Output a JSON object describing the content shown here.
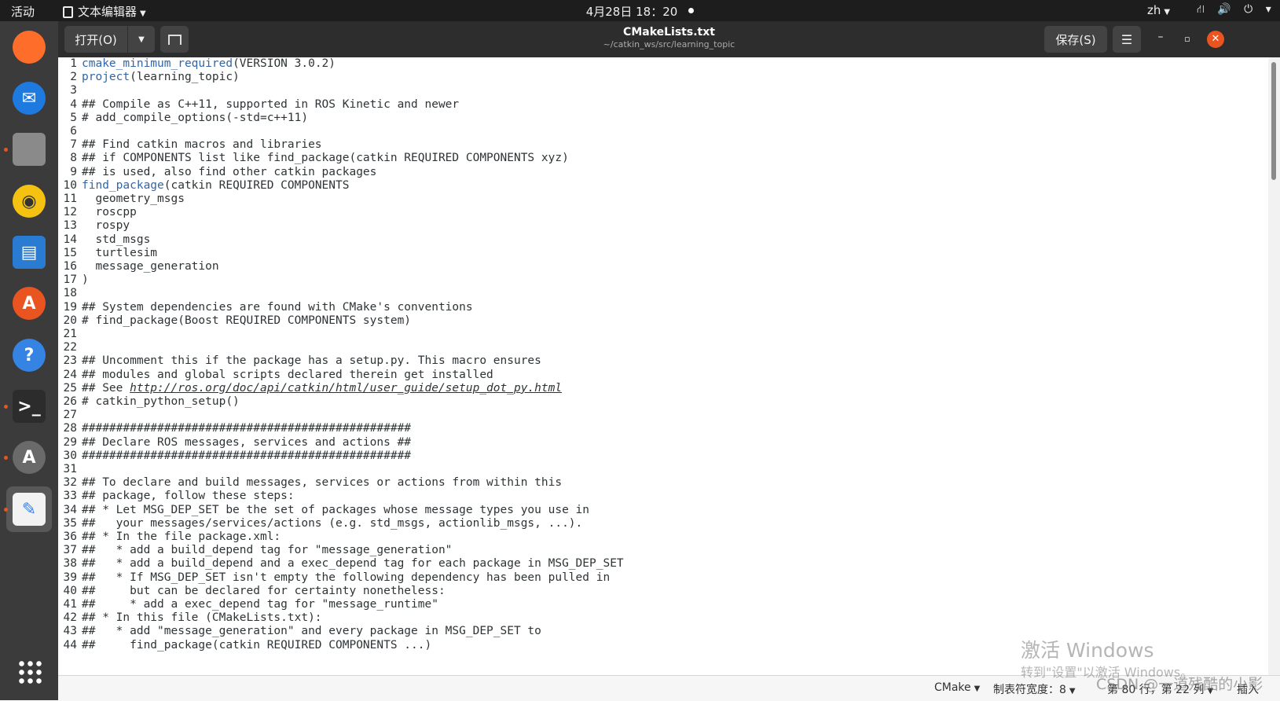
{
  "topbar": {
    "activities": "活动",
    "app_name": "文本编辑器",
    "clock": "4月28日  18：20",
    "lang": "zh",
    "system_icons": "⛙ 🔊 ⏻ ▾"
  },
  "dock": {
    "items": [
      {
        "name": "firefox",
        "label": "",
        "color": "#ff6d2a"
      },
      {
        "name": "thunderbird",
        "label": "✉",
        "color": "#1f7ae0"
      },
      {
        "name": "files",
        "label": "",
        "color": "#8a8a8a"
      },
      {
        "name": "rhythmbox",
        "label": "◉",
        "color": "#f5c211"
      },
      {
        "name": "libreoffice-writer",
        "label": "▤",
        "color": "#2a7cd3"
      },
      {
        "name": "ubuntu-software",
        "label": "A",
        "color": "#e95420"
      },
      {
        "name": "help",
        "label": "?",
        "color": "#3584e4"
      },
      {
        "name": "terminal",
        "label": ">_",
        "color": "#2c2c2c"
      },
      {
        "name": "software-updater",
        "label": "A",
        "color": "#6a6a6a"
      },
      {
        "name": "text-editor",
        "label": "✎",
        "color": "#f2f2f2"
      }
    ]
  },
  "header": {
    "open_label": "打开(O)",
    "title": "CMakeLists.txt",
    "path": "~/catkin_ws/src/learning_topic",
    "save_label": "保存(S)",
    "menu_icon": "☰",
    "minimize": "–",
    "maximize": "▫",
    "close": "✕"
  },
  "editor": {
    "lines": [
      {
        "n": "1",
        "fn": "cmake_minimum_required",
        "text": "(VERSION 3.0.2)"
      },
      {
        "n": "2",
        "fn": "project",
        "text": "(learning_topic)"
      },
      {
        "n": "3",
        "text": ""
      },
      {
        "n": "4",
        "text": "## Compile as C++11, supported in ROS Kinetic and newer"
      },
      {
        "n": "5",
        "text": "# add_compile_options(-std=c++11)"
      },
      {
        "n": "6",
        "text": ""
      },
      {
        "n": "7",
        "text": "## Find catkin macros and libraries"
      },
      {
        "n": "8",
        "text": "## if COMPONENTS list like find_package(catkin REQUIRED COMPONENTS xyz)"
      },
      {
        "n": "9",
        "text": "## is used, also find other catkin packages"
      },
      {
        "n": "10",
        "fn": "find_package",
        "text": "(catkin REQUIRED COMPONENTS"
      },
      {
        "n": "11",
        "text": "  geometry_msgs"
      },
      {
        "n": "12",
        "text": "  roscpp"
      },
      {
        "n": "13",
        "text": "  rospy"
      },
      {
        "n": "14",
        "text": "  std_msgs"
      },
      {
        "n": "15",
        "text": "  turtlesim"
      },
      {
        "n": "16",
        "text": "  message_generation"
      },
      {
        "n": "17",
        "text": ")"
      },
      {
        "n": "18",
        "text": ""
      },
      {
        "n": "19",
        "text": "## System dependencies are found with CMake's conventions"
      },
      {
        "n": "20",
        "text": "# find_package(Boost REQUIRED COMPONENTS system)"
      },
      {
        "n": "21",
        "text": ""
      },
      {
        "n": "22",
        "text": ""
      },
      {
        "n": "23",
        "text": "## Uncomment this if the package has a setup.py. This macro ensures"
      },
      {
        "n": "24",
        "text": "## modules and global scripts declared therein get installed"
      },
      {
        "n": "25",
        "text": "## See ",
        "url": "http://ros.org/doc/api/catkin/html/user_guide/setup_dot_py.html"
      },
      {
        "n": "26",
        "text": "# catkin_python_setup()"
      },
      {
        "n": "27",
        "text": ""
      },
      {
        "n": "28",
        "text": "################################################"
      },
      {
        "n": "29",
        "text": "## Declare ROS messages, services and actions ##"
      },
      {
        "n": "30",
        "text": "################################################"
      },
      {
        "n": "31",
        "text": ""
      },
      {
        "n": "32",
        "text": "## To declare and build messages, services or actions from within this"
      },
      {
        "n": "33",
        "text": "## package, follow these steps:"
      },
      {
        "n": "34",
        "text": "## * Let MSG_DEP_SET be the set of packages whose message types you use in"
      },
      {
        "n": "35",
        "text": "##   your messages/services/actions (e.g. std_msgs, actionlib_msgs, ...)."
      },
      {
        "n": "36",
        "text": "## * In the file package.xml:"
      },
      {
        "n": "37",
        "text": "##   * add a build_depend tag for \"message_generation\""
      },
      {
        "n": "38",
        "text": "##   * add a build_depend and a exec_depend tag for each package in MSG_DEP_SET"
      },
      {
        "n": "39",
        "text": "##   * If MSG_DEP_SET isn't empty the following dependency has been pulled in"
      },
      {
        "n": "40",
        "text": "##     but can be declared for certainty nonetheless:"
      },
      {
        "n": "41",
        "text": "##     * add a exec_depend tag for \"message_runtime\""
      },
      {
        "n": "42",
        "text": "## * In this file (CMakeLists.txt):"
      },
      {
        "n": "43",
        "text": "##   * add \"message_generation\" and every package in MSG_DEP_SET to"
      },
      {
        "n": "44",
        "text": "##     find_package(catkin REQUIRED COMPONENTS ...)"
      }
    ]
  },
  "status": {
    "language": "CMake",
    "tab_width": "制表符宽度：8",
    "cursor": "第 80 行，第 22 列",
    "mode": "插入"
  },
  "watermark": {
    "activate_title": "激活 Windows",
    "activate_sub": "转到\"设置\"以激活 Windows。",
    "csdn": "CSDN @一道残酷的小影"
  }
}
